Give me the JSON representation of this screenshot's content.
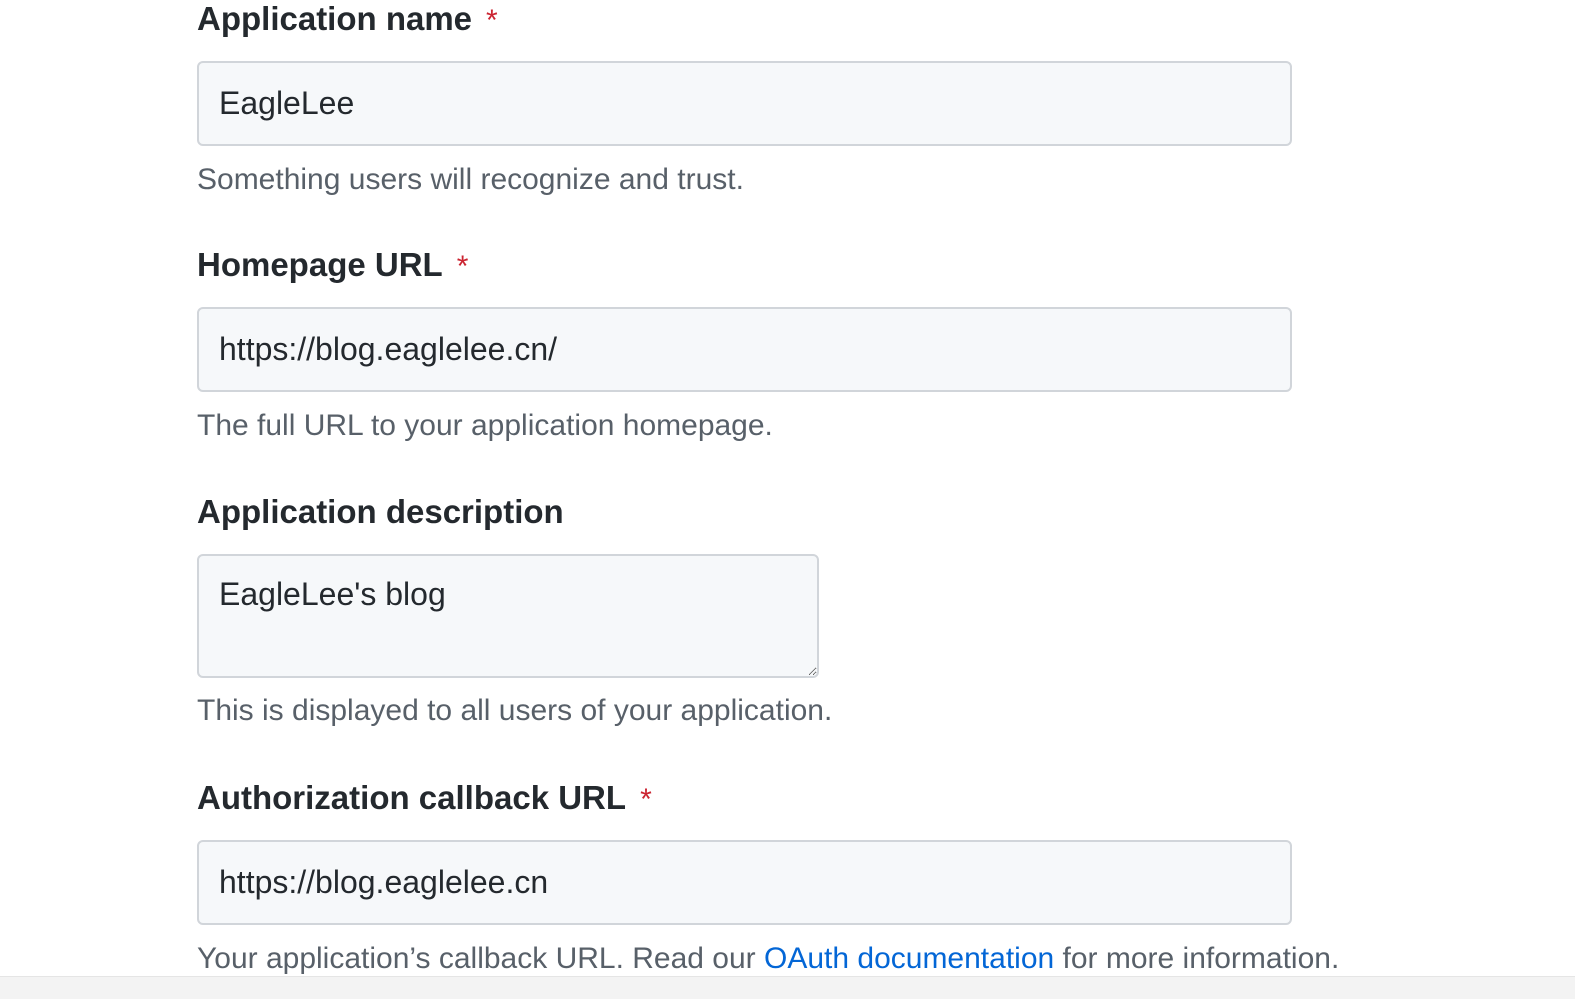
{
  "form": {
    "app_name": {
      "label": "Application name",
      "required_mark": "*",
      "value": "EagleLee",
      "note": "Something users will recognize and trust."
    },
    "homepage_url": {
      "label": "Homepage URL",
      "required_mark": "*",
      "value": "https://blog.eaglelee.cn/",
      "note": "The full URL to your application homepage."
    },
    "description": {
      "label": "Application description",
      "value": "EagleLee's blog",
      "note": "This is displayed to all users of your application."
    },
    "callback_url": {
      "label": "Authorization callback URL",
      "required_mark": "*",
      "value": "https://blog.eaglelee.cn",
      "note_prefix": "Your application’s callback URL. Read our ",
      "note_link": "OAuth documentation",
      "note_suffix": " for more information."
    }
  },
  "colors": {
    "required": "#cb2431",
    "link": "#0366d6",
    "input_bg": "#f6f8fa",
    "input_border": "#d1d5da",
    "note_text": "#586069"
  }
}
